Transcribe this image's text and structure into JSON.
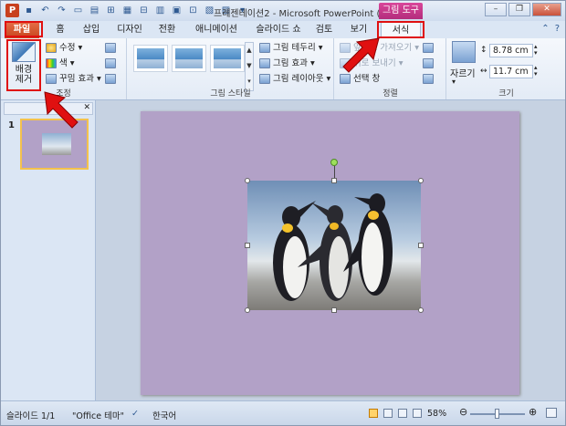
{
  "title_bar": {
    "app_icon": "P",
    "title": "프레젠테이션2 - Microsoft PowerPoint (...",
    "context_tab_title": "그림 도구",
    "window_buttons": [
      "–",
      "❐",
      "✕"
    ]
  },
  "tabs": [
    {
      "label": "파일"
    },
    {
      "label": "홈"
    },
    {
      "label": "삽입"
    },
    {
      "label": "디자인"
    },
    {
      "label": "전환"
    },
    {
      "label": "애니메이션"
    },
    {
      "label": "슬라이드 쇼"
    },
    {
      "label": "검토"
    },
    {
      "label": "보기"
    },
    {
      "label": "서식"
    }
  ],
  "ribbon": {
    "adjust": {
      "remove_bg_line1": "배경",
      "remove_bg_line2": "제거",
      "corrections": "수정 ▾",
      "color": "색 ▾",
      "artistic": "꾸밈 효과 ▾",
      "label": "조정"
    },
    "styles": {
      "border": "그림 테두리 ▾",
      "effects": "그림 효과 ▾",
      "layout": "그림 레이아웃 ▾",
      "label": "그림 스타일"
    },
    "arrange": {
      "bring_forward": "앞으로 가져오기 ▾",
      "send_backward": "뒤로 보내기 ▾",
      "selection_pane": "선택 창",
      "label": "정렬"
    },
    "size": {
      "crop": "자르기",
      "height": "8.78 cm",
      "width": "11.7 cm",
      "label": "크기"
    }
  },
  "slides_panel": {
    "slide_number": "1"
  },
  "status_bar": {
    "slide": "슬라이드 1/1",
    "theme": "\"Office 테마\"",
    "language": "한국어",
    "zoom": "58%"
  },
  "colors": {
    "slide_bg": "#b2a1c7",
    "file_tab": "#c6451d",
    "context_tab": "#b32c7c",
    "callout_red": "#e01010"
  }
}
